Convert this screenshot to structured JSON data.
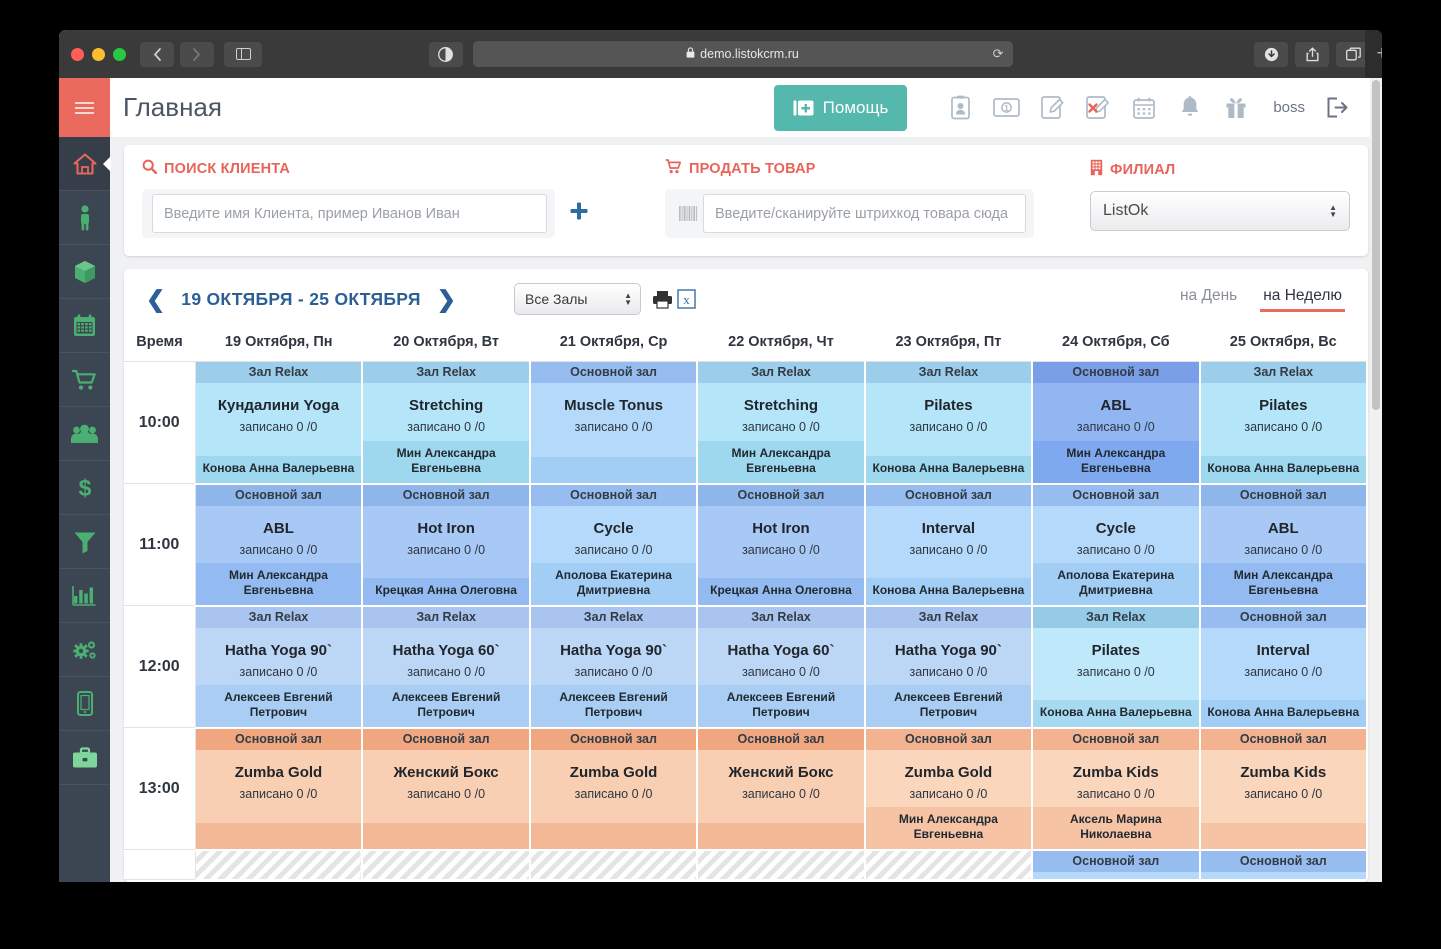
{
  "browser": {
    "url": "demo.listokcrm.ru",
    "lock_icon": "lock-icon",
    "back_icon": "chevron-left-icon",
    "forward_icon": "chevron-right-icon",
    "sidebar_icon": "sidebar-toggle-icon",
    "reader_icon": "reader-view-icon",
    "reload_icon": "reload-icon",
    "download_icon": "download-icon",
    "share_icon": "share-icon",
    "tabs_icon": "tab-overview-icon",
    "newtab_icon": "plus-icon"
  },
  "header": {
    "title": "Главная",
    "menu_icon": "hamburger-icon",
    "help_label": "Помощь",
    "help_icon": "first-aid-kit-icon",
    "user": "boss",
    "accent": "#54b8ac",
    "icons": [
      "id-card-icon",
      "money-bill-icon",
      "edit-note-icon",
      "cancel-note-icon",
      "calendar-grid-icon",
      "bell-icon",
      "gift-icon"
    ],
    "logout_icon": "logout-icon"
  },
  "sidebar": {
    "bg": "#3c4652",
    "active_bg": "#ea6a5e",
    "items": [
      {
        "icon": "home-icon",
        "name": "sidebar-item-home",
        "active": true
      },
      {
        "icon": "person-icon",
        "name": "sidebar-item-clients",
        "active": false
      },
      {
        "icon": "box-icon",
        "name": "sidebar-item-products",
        "active": false
      },
      {
        "icon": "calendar-icon",
        "name": "sidebar-item-schedule",
        "active": false
      },
      {
        "icon": "cart-icon",
        "name": "sidebar-item-sales",
        "active": false
      },
      {
        "icon": "group-icon",
        "name": "sidebar-item-staff",
        "active": false
      },
      {
        "icon": "dollar-icon",
        "name": "sidebar-item-finance",
        "active": false
      },
      {
        "icon": "funnel-icon",
        "name": "sidebar-item-funnel",
        "active": false
      },
      {
        "icon": "bar-chart-icon",
        "name": "sidebar-item-reports",
        "active": false
      },
      {
        "icon": "gears-icon",
        "name": "sidebar-item-settings",
        "active": false
      },
      {
        "icon": "mobile-icon",
        "name": "sidebar-item-mobile",
        "active": false
      },
      {
        "icon": "briefcase-icon",
        "name": "sidebar-item-business",
        "active": false
      }
    ]
  },
  "search_panel": {
    "accent": "#e8645a",
    "client": {
      "label": "ПОИСК КЛИЕНТА",
      "icon": "search-icon",
      "placeholder": "Введите имя Клиента, пример Иванов Иван",
      "value": "",
      "add_label": "+"
    },
    "goods": {
      "label": "ПРОДАТЬ ТОВАР",
      "icon": "cart-icon",
      "barcode_icon": "barcode-icon",
      "placeholder": "Введите/сканируйте штрихкод товара сюда",
      "value": ""
    },
    "branch": {
      "label": "ФИЛИАЛ",
      "icon": "building-icon",
      "selected": "ListOk",
      "options": [
        "ListOk"
      ]
    }
  },
  "schedule": {
    "prev_icon": "chevron-left-icon",
    "next_icon": "chevron-right-icon",
    "date_range": "19 ОКТЯБРЯ - 25 ОКТЯБРЯ",
    "hall_filter": {
      "selected": "Все Залы",
      "options": [
        "Все Залы"
      ]
    },
    "print_icon": "printer-icon",
    "excel_icon": "excel-export-icon",
    "tabs": [
      {
        "label": "на День",
        "active": false
      },
      {
        "label": "на Неделю",
        "active": true
      }
    ],
    "time_header": "Время",
    "days": [
      "19 Октября, Пн",
      "20 Октября, Вт",
      "21 Октября, Ср",
      "22 Октября, Чт",
      "23 Октября, Пт",
      "24 Октября, Сб",
      "25 Октября, Вс"
    ],
    "rows": [
      {
        "time": "10:00",
        "cells": [
          {
            "hall": "Зал Relax",
            "name": "Кундалини Yoga",
            "recorded": "записано 0 /0",
            "coach": "Конова Анна Валерьевна",
            "color": "c-blue1"
          },
          {
            "hall": "Зал Relax",
            "name": "Stretching",
            "recorded": "записано 0 /0",
            "coach": "Мин Александра Евгеньевна",
            "color": "c-blue1"
          },
          {
            "hall": "Основной зал",
            "name": "Muscle Tonus",
            "recorded": "записано 0 /0",
            "coach": "",
            "color": "c-blue4"
          },
          {
            "hall": "Зал Relax",
            "name": "Stretching",
            "recorded": "записано 0 /0",
            "coach": "Мин Александра Евгеньевна",
            "color": "c-blue1"
          },
          {
            "hall": "Зал Relax",
            "name": "Pilates",
            "recorded": "записано 0 /0",
            "coach": "Конова Анна Валерьевна",
            "color": "c-blue1"
          },
          {
            "hall": "Основной зал",
            "name": "ABL",
            "recorded": "записано 0 /0",
            "coach": "Мин Александра Евгеньевна",
            "color": "c-blue3"
          },
          {
            "hall": "Зал Relax",
            "name": "Pilates",
            "recorded": "записано 0 /0",
            "coach": "Конова Анна Валерьевна",
            "color": "c-blue1"
          }
        ]
      },
      {
        "time": "11:00",
        "cells": [
          {
            "hall": "Основной зал",
            "name": "ABL",
            "recorded": "записано 0 /0",
            "coach": "Мин Александра Евгеньевна",
            "color": "c-blue5"
          },
          {
            "hall": "Основной зал",
            "name": "Hot Iron",
            "recorded": "записано 0 /0",
            "coach": "Крецкая Анна Олеговна",
            "color": "c-blue5"
          },
          {
            "hall": "Основной зал",
            "name": "Cycle",
            "recorded": "записано 0 /0",
            "coach": "Аполова Екатерина Дмитриевна",
            "color": "c-blue4"
          },
          {
            "hall": "Основной зал",
            "name": "Hot Iron",
            "recorded": "записано 0 /0",
            "coach": "Крецкая Анна Олеговна",
            "color": "c-blue5"
          },
          {
            "hall": "Основной зал",
            "name": "Interval",
            "recorded": "записано 0 /0",
            "coach": "Конова Анна Валерьевна",
            "color": "c-blue4"
          },
          {
            "hall": "Основной зал",
            "name": "Cycle",
            "recorded": "записано 0 /0",
            "coach": "Аполова Екатерина Дмитриевна",
            "color": "c-blue4"
          },
          {
            "hall": "Основной зал",
            "name": "ABL",
            "recorded": "записано 0 /0",
            "coach": "Мин Александра Евгеньевна",
            "color": "c-blue5"
          }
        ]
      },
      {
        "time": "12:00",
        "cells": [
          {
            "hall": "Зал Relax",
            "name": "Hatha Yoga 90`",
            "recorded": "записано 0 /0",
            "coach": "Алексеев Евгений Петрович",
            "color": "c-blue2"
          },
          {
            "hall": "Зал Relax",
            "name": "Hatha Yoga 60`",
            "recorded": "записано 0 /0",
            "coach": "Алексеев Евгений Петрович",
            "color": "c-blue2"
          },
          {
            "hall": "Зал Relax",
            "name": "Hatha Yoga 90`",
            "recorded": "записано 0 /0",
            "coach": "Алексеев Евгений Петрович",
            "color": "c-blue2"
          },
          {
            "hall": "Зал Relax",
            "name": "Hatha Yoga 60`",
            "recorded": "записано 0 /0",
            "coach": "Алексеев Евгений Петрович",
            "color": "c-blue2"
          },
          {
            "hall": "Зал Relax",
            "name": "Hatha Yoga 90`",
            "recorded": "записано 0 /0",
            "coach": "Алексеев Евгений Петрович",
            "color": "c-blue2"
          },
          {
            "hall": "Зал Relax",
            "name": "Pilates",
            "recorded": "записано 0 /0",
            "coach": "Конова Анна Валерьевна",
            "color": "c-sky"
          },
          {
            "hall": "Основной зал",
            "name": "Interval",
            "recorded": "записано 0 /0",
            "coach": "Конова Анна Валерьевна",
            "color": "c-blue4"
          }
        ]
      },
      {
        "time": "13:00",
        "cells": [
          {
            "hall": "Основной зал",
            "name": "Zumba Gold",
            "recorded": "записано 0 /0",
            "coach": "",
            "color": "c-orange"
          },
          {
            "hall": "Основной зал",
            "name": "Женский Бокс",
            "recorded": "записано 0 /0",
            "coach": "",
            "color": "c-orange"
          },
          {
            "hall": "Основной зал",
            "name": "Zumba Gold",
            "recorded": "записано 0 /0",
            "coach": "",
            "color": "c-orange"
          },
          {
            "hall": "Основной зал",
            "name": "Женский Бокс",
            "recorded": "записано 0 /0",
            "coach": "",
            "color": "c-orange"
          },
          {
            "hall": "Основной зал",
            "name": "Zumba Gold",
            "recorded": "записано 0 /0",
            "coach": "Мин Александра Евгеньевна",
            "color": "c-orange2"
          },
          {
            "hall": "Основной зал",
            "name": "Zumba Kids",
            "recorded": "записано 0 /0",
            "coach": "Аксель Марина Николаевна",
            "color": "c-orange2"
          },
          {
            "hall": "Основной зал",
            "name": "Zumba Kids",
            "recorded": "записано 0 /0",
            "coach": "",
            "color": "c-orange2"
          }
        ]
      },
      {
        "time": "",
        "partial": true,
        "cells": [
          {
            "hall": "",
            "name": "",
            "recorded": "",
            "coach": "",
            "color": "hatch"
          },
          {
            "hall": "",
            "name": "",
            "recorded": "",
            "coach": "",
            "color": "hatch"
          },
          {
            "hall": "",
            "name": "",
            "recorded": "",
            "coach": "",
            "color": "hatch"
          },
          {
            "hall": "",
            "name": "",
            "recorded": "",
            "coach": "",
            "color": "hatch"
          },
          {
            "hall": "",
            "name": "",
            "recorded": "",
            "coach": "",
            "color": "hatch"
          },
          {
            "hall": "Основной зал",
            "name": "",
            "recorded": "",
            "coach": "",
            "color": "c-blue4"
          },
          {
            "hall": "Основной зал",
            "name": "",
            "recorded": "",
            "coach": "",
            "color": "c-blue4"
          }
        ]
      }
    ]
  }
}
